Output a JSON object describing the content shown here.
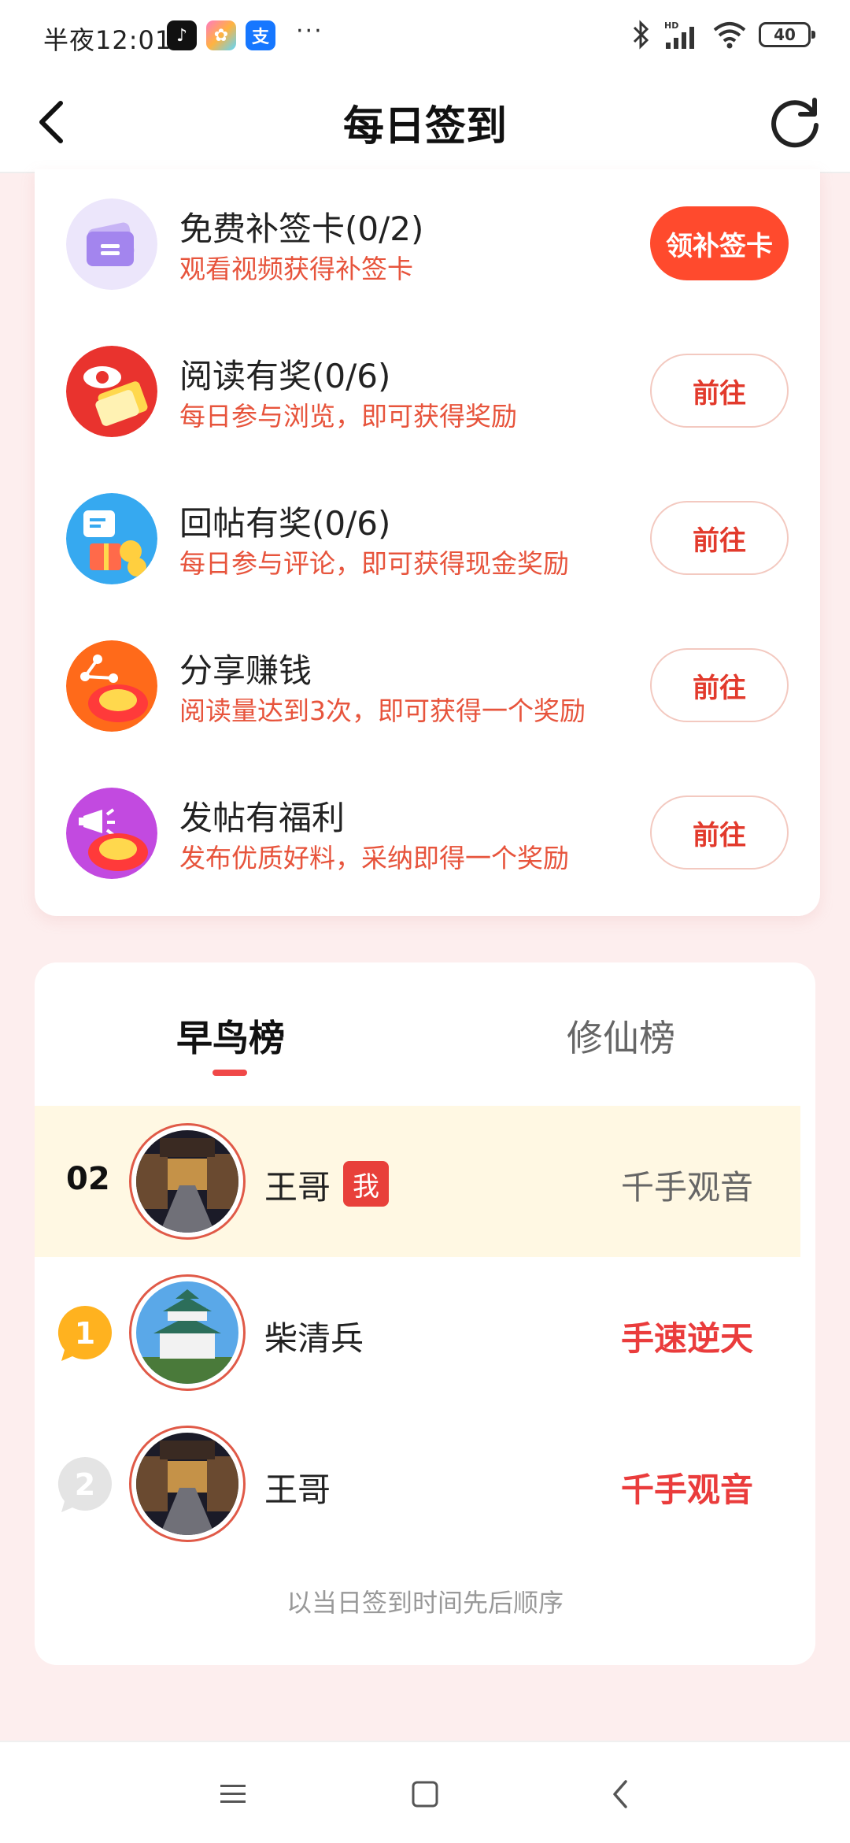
{
  "status_bar": {
    "time": "半夜12:01",
    "app_icons": [
      {
        "name": "tiktok-icon",
        "glyph": "♪",
        "color": "#111111"
      },
      {
        "name": "gallery-icon",
        "glyph": "✿",
        "color": "#f06fb0"
      },
      {
        "name": "alipay-icon",
        "glyph": "支",
        "color": "#1677ff"
      }
    ],
    "more": "···",
    "battery": "40"
  },
  "header": {
    "title": "每日签到"
  },
  "tasks": [
    {
      "title": "免费补签卡(0/2)",
      "desc": "观看视频获得补签卡",
      "button": "领补签卡",
      "primary": true,
      "icon": "ticket-icon"
    },
    {
      "title": "阅读有奖(0/6)",
      "desc": "每日参与浏览，即可获得奖励",
      "button": "前往",
      "primary": false,
      "icon": "eye-book-icon"
    },
    {
      "title": "回帖有奖(0/6)",
      "desc": "每日参与评论，即可获得现金奖励",
      "button": "前往",
      "primary": false,
      "icon": "comment-gift-icon"
    },
    {
      "title": "分享赚钱",
      "desc": "阅读量达到3次，即可获得一个奖励",
      "button": "前往",
      "primary": false,
      "icon": "share-coin-icon"
    },
    {
      "title": "发帖有福利",
      "desc": "发布优质好料，采纳即得一个奖励",
      "button": "前往",
      "primary": false,
      "icon": "megaphone-coin-icon"
    }
  ],
  "leaderboard": {
    "tabs": [
      "早鸟榜",
      "修仙榜"
    ],
    "active_tab": 0,
    "me": {
      "rank": "02",
      "name": "王哥",
      "badge": "我",
      "title": "千手观音"
    },
    "rows": [
      {
        "rank": "1",
        "name": "柴清兵",
        "title": "手速逆天"
      },
      {
        "rank": "2",
        "name": "王哥",
        "title": "千手观音"
      }
    ],
    "footnote": "以当日签到时间先后顺序"
  },
  "colors": {
    "accent_red": "#ff4a2d",
    "desc_orange": "#e7543c",
    "highlight_row": "#fff8e3",
    "page_bg": "#fdeeee"
  }
}
